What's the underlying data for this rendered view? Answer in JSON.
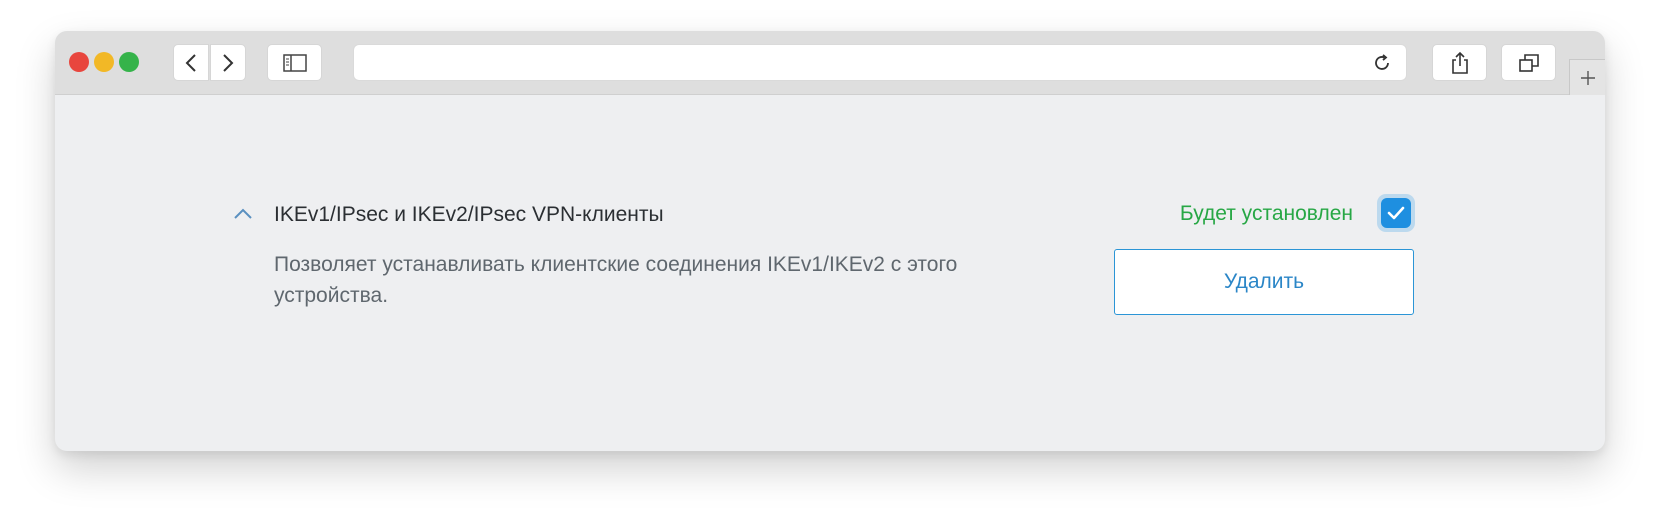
{
  "browser": {
    "traffic_lights": {
      "close_color": "#e8463e",
      "minimize_color": "#f2b826",
      "zoom_color": "#35b34a"
    },
    "icons": {
      "back": "chevron-left-icon",
      "forward": "chevron-right-icon",
      "sidebar": "sidebar-icon",
      "reload": "reload-icon",
      "share": "share-icon",
      "tabs": "tabs-overview-icon",
      "new_tab": "plus-icon"
    },
    "address_value": ""
  },
  "component": {
    "title": "IKEv1/IPsec и IKEv2/IPsec VPN-клиенты",
    "description": "Позволяет устанавливать клиентские соединения IKEv1/IKEv2 с этого устройства.",
    "status": "Будет установлен",
    "checked": true,
    "delete_label": "Удалить",
    "colors": {
      "status": "#27a745",
      "accent": "#1e8fe0"
    }
  }
}
